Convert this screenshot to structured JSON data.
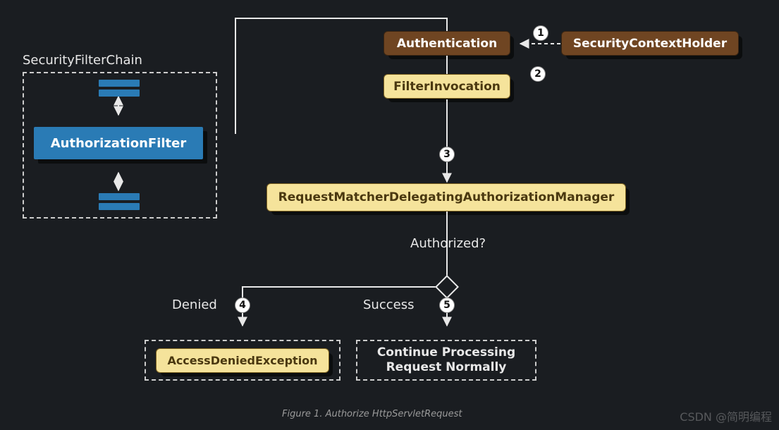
{
  "chain": {
    "title": "SecurityFilterChain",
    "filter_label": "AuthorizationFilter"
  },
  "nodes": {
    "authentication": "Authentication",
    "context_holder": "SecurityContextHolder",
    "filter_invocation": "FilterInvocation",
    "manager": "RequestMatcherDelegatingAuthorizationManager",
    "access_denied": "AccessDeniedException",
    "continue_lines": [
      "Continue Processing",
      "Request Normally"
    ]
  },
  "labels": {
    "authorized": "Authorized?",
    "denied": "Denied",
    "success": "Success"
  },
  "steps": {
    "s1": "1",
    "s2": "2",
    "s3": "3",
    "s4": "4",
    "s5": "5"
  },
  "caption": "Figure 1. Authorize HttpServletRequest",
  "watermark": "CSDN @简明编程"
}
